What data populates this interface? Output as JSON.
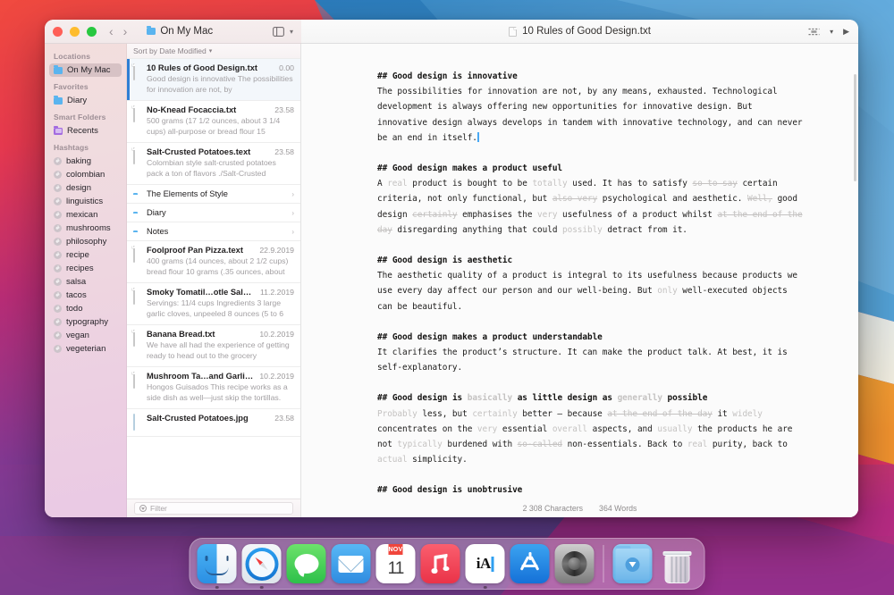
{
  "window": {
    "traffic_lights": [
      "close",
      "minimize",
      "maximize"
    ],
    "location_label": "On My Mac",
    "document_title": "10 Rules of Good Design.txt",
    "sort_label": "Sort by Date Modified"
  },
  "sidebar": {
    "sections": [
      {
        "header": "Locations",
        "items": [
          {
            "label": "On My Mac",
            "icon": "folder-icon",
            "selected": true
          }
        ]
      },
      {
        "header": "Favorites",
        "items": [
          {
            "label": "Diary",
            "icon": "folder-icon",
            "selected": false
          }
        ]
      },
      {
        "header": "Smart Folders",
        "items": [
          {
            "label": "Recents",
            "icon": "smart-folder-icon",
            "selected": false
          }
        ]
      },
      {
        "header": "Hashtags",
        "items": [
          {
            "label": "baking",
            "icon": "hashtag-icon",
            "selected": false
          },
          {
            "label": "colombian",
            "icon": "hashtag-icon",
            "selected": false
          },
          {
            "label": "design",
            "icon": "hashtag-icon",
            "selected": false
          },
          {
            "label": "linguistics",
            "icon": "hashtag-icon",
            "selected": false
          },
          {
            "label": "mexican",
            "icon": "hashtag-icon",
            "selected": false
          },
          {
            "label": "mushrooms",
            "icon": "hashtag-icon",
            "selected": false
          },
          {
            "label": "philosophy",
            "icon": "hashtag-icon",
            "selected": false
          },
          {
            "label": "recipe",
            "icon": "hashtag-icon",
            "selected": false
          },
          {
            "label": "recipes",
            "icon": "hashtag-icon",
            "selected": false
          },
          {
            "label": "salsa",
            "icon": "hashtag-icon",
            "selected": false
          },
          {
            "label": "tacos",
            "icon": "hashtag-icon",
            "selected": false
          },
          {
            "label": "todo",
            "icon": "hashtag-icon",
            "selected": false
          },
          {
            "label": "typography",
            "icon": "hashtag-icon",
            "selected": false
          },
          {
            "label": "vegan",
            "icon": "hashtag-icon",
            "selected": false
          },
          {
            "label": "vegeterian",
            "icon": "hashtag-icon",
            "selected": false
          }
        ]
      }
    ]
  },
  "file_list": {
    "filter_placeholder": "Filter",
    "rows": [
      {
        "type": "file",
        "icon": "document-icon",
        "name": "10 Rules of Good Design.txt",
        "date": "0.00",
        "preview": "Good design is innovative The possibilities for innovation are not, by",
        "selected": true
      },
      {
        "type": "file",
        "icon": "document-icon",
        "name": "No-Knead Focaccia.txt",
        "date": "23.58",
        "preview": "500 grams (17 1/2 ounces, about 3 1/4 cups) all-purpose or bread flour 15",
        "selected": false
      },
      {
        "type": "file",
        "icon": "document-icon",
        "name": "Salt-Crusted Potatoes.text",
        "date": "23.58",
        "preview": "Colombian style salt-crusted potatoes pack a ton of flavors ./Salt-Crusted",
        "selected": false
      },
      {
        "type": "folder",
        "icon": "folder-icon",
        "name": "The Elements of Style",
        "chevron": "›"
      },
      {
        "type": "folder",
        "icon": "folder-icon",
        "name": "Diary",
        "chevron": "›"
      },
      {
        "type": "folder",
        "icon": "folder-icon",
        "name": "Notes",
        "chevron": "›"
      },
      {
        "type": "file",
        "icon": "document-icon",
        "name": "Foolproof Pan Pizza.text",
        "date": "22.9.2019",
        "preview": "400 grams (14 ounces, about 2 1/2 cups) bread flour 10 grams (.35 ounces, about",
        "selected": false
      },
      {
        "type": "file",
        "icon": "document-icon",
        "name": "Smoky Tomatil…otle Salsa.text",
        "date": "11.2.2019",
        "preview": "Servings: 11/4 cups Ingredients 3 large garlic cloves, unpeeled 8 ounces (5 to 6",
        "selected": false
      },
      {
        "type": "file",
        "icon": "document-icon",
        "name": "Banana Bread.txt",
        "date": "10.2.2019",
        "preview": "We have all had the experience of getting ready to head out to the grocery",
        "selected": false
      },
      {
        "type": "file",
        "icon": "document-icon",
        "name": "Mushroom Ta…and Garlic.text",
        "date": "10.2.2019",
        "preview": "Hongos Guisados This recipe works as a side dish as well—just skip the tortillas.",
        "selected": false
      },
      {
        "type": "image",
        "icon": "image-icon",
        "name": "Salt-Crusted Potatoes.jpg",
        "date": "23.58",
        "preview": "",
        "selected": false
      }
    ]
  },
  "editor": {
    "status": {
      "characters": "2 308 Characters",
      "words": "364 Words"
    },
    "blocks": [
      {
        "kind": "heading",
        "hashes": "##",
        "runs": [
          {
            "t": "Good design is innovative",
            "s": "normal"
          }
        ]
      },
      {
        "kind": "paragraph",
        "runs": [
          {
            "t": "The possibilities for innovation are not, by any means, exhausted. Technological development is always offering new opportunities for innovative design. But innovative design always develops in tandem with innovative technology, and can never be an end in itself.",
            "s": "normal"
          },
          {
            "t": "",
            "s": "caret"
          }
        ]
      },
      {
        "kind": "heading",
        "hashes": "##",
        "runs": [
          {
            "t": "Good design makes a product useful",
            "s": "normal"
          }
        ]
      },
      {
        "kind": "paragraph",
        "runs": [
          {
            "t": "A ",
            "s": "normal"
          },
          {
            "t": "real",
            "s": "dim"
          },
          {
            "t": " product is bought to be ",
            "s": "normal"
          },
          {
            "t": "totally",
            "s": "dim"
          },
          {
            "t": " used. It has to satisfy ",
            "s": "normal"
          },
          {
            "t": "so to say",
            "s": "strike"
          },
          {
            "t": " certain criteria, not only functional, but ",
            "s": "normal"
          },
          {
            "t": "also very",
            "s": "strike"
          },
          {
            "t": " psychological and aesthetic. ",
            "s": "normal"
          },
          {
            "t": "Well,",
            "s": "strike"
          },
          {
            "t": " good design ",
            "s": "normal"
          },
          {
            "t": "certainly",
            "s": "strike"
          },
          {
            "t": " emphasises the ",
            "s": "normal"
          },
          {
            "t": "very",
            "s": "dim"
          },
          {
            "t": " usefulness of a product whilst ",
            "s": "normal"
          },
          {
            "t": "at the end of the day",
            "s": "strike"
          },
          {
            "t": " disregarding anything that could ",
            "s": "normal"
          },
          {
            "t": "possibly",
            "s": "dim"
          },
          {
            "t": " detract from it.",
            "s": "normal"
          }
        ]
      },
      {
        "kind": "heading",
        "hashes": "##",
        "runs": [
          {
            "t": "Good design is aesthetic",
            "s": "normal"
          }
        ]
      },
      {
        "kind": "paragraph",
        "runs": [
          {
            "t": "The aesthetic quality of a product is integral to its usefulness because products we use every day affect our person and our well-being. But ",
            "s": "normal"
          },
          {
            "t": "only",
            "s": "dim"
          },
          {
            "t": " well-executed objects can be beautiful.",
            "s": "normal"
          }
        ]
      },
      {
        "kind": "heading",
        "hashes": "##",
        "runs": [
          {
            "t": "Good design makes a product understandable",
            "s": "normal"
          }
        ]
      },
      {
        "kind": "paragraph",
        "runs": [
          {
            "t": "It clarifies the product’s structure. It can make the product talk. At best, it is self-explanatory.",
            "s": "normal"
          }
        ]
      },
      {
        "kind": "heading",
        "hashes": "##",
        "runs": [
          {
            "t": "Good design is ",
            "s": "normal"
          },
          {
            "t": "basically",
            "s": "dim"
          },
          {
            "t": " as little design as ",
            "s": "normal"
          },
          {
            "t": "generally",
            "s": "dim"
          },
          {
            "t": " possible",
            "s": "normal"
          }
        ]
      },
      {
        "kind": "paragraph",
        "runs": [
          {
            "t": "Probably",
            "s": "dim"
          },
          {
            "t": " less, but ",
            "s": "normal"
          },
          {
            "t": "certainly",
            "s": "dim"
          },
          {
            "t": " better – because ",
            "s": "normal"
          },
          {
            "t": "at the end of the day",
            "s": "strike"
          },
          {
            "t": " it ",
            "s": "normal"
          },
          {
            "t": "widely",
            "s": "dim"
          },
          {
            "t": " concentrates on the ",
            "s": "normal"
          },
          {
            "t": "very",
            "s": "dim"
          },
          {
            "t": " essential ",
            "s": "normal"
          },
          {
            "t": "overall",
            "s": "dim"
          },
          {
            "t": " aspects, and ",
            "s": "normal"
          },
          {
            "t": "usually",
            "s": "dim"
          },
          {
            "t": " the products he are not ",
            "s": "normal"
          },
          {
            "t": "typically",
            "s": "dim"
          },
          {
            "t": " burdened with ",
            "s": "normal"
          },
          {
            "t": "so-called",
            "s": "strike"
          },
          {
            "t": " non-essentials. Back to ",
            "s": "normal"
          },
          {
            "t": "real",
            "s": "dim"
          },
          {
            "t": " purity, back to ",
            "s": "normal"
          },
          {
            "t": "actual",
            "s": "dim"
          },
          {
            "t": " simplicity.",
            "s": "normal"
          }
        ]
      },
      {
        "kind": "heading",
        "hashes": "##",
        "runs": [
          {
            "t": "Good design is unobtrusive",
            "s": "normal"
          }
        ]
      }
    ]
  },
  "dock": {
    "items": [
      {
        "name": "Finder",
        "icon": "finder-icon",
        "running": true
      },
      {
        "name": "Safari",
        "icon": "safari-icon",
        "running": true
      },
      {
        "name": "Messages",
        "icon": "messages-icon",
        "running": false
      },
      {
        "name": "Mail",
        "icon": "mail-icon",
        "running": false
      },
      {
        "name": "Calendar",
        "icon": "calendar-icon",
        "running": false,
        "month": "NOV",
        "day": "11"
      },
      {
        "name": "Music",
        "icon": "music-icon",
        "running": false
      },
      {
        "name": "iA Writer",
        "icon": "ia-writer-icon",
        "running": true,
        "glyph": "iA"
      },
      {
        "name": "App Store",
        "icon": "app-store-icon",
        "running": false
      },
      {
        "name": "System Preferences",
        "icon": "system-preferences-icon",
        "running": false
      }
    ],
    "extras": [
      {
        "name": "Downloads",
        "icon": "downloads-folder-icon"
      },
      {
        "name": "Trash",
        "icon": "trash-icon"
      }
    ]
  },
  "colors": {
    "accent": "#2f7fd4",
    "caret": "#49a9f5",
    "dim_text": "#c4c2c1",
    "sidebar_start": "#f3dedd",
    "sidebar_end": "#eac9e4"
  }
}
